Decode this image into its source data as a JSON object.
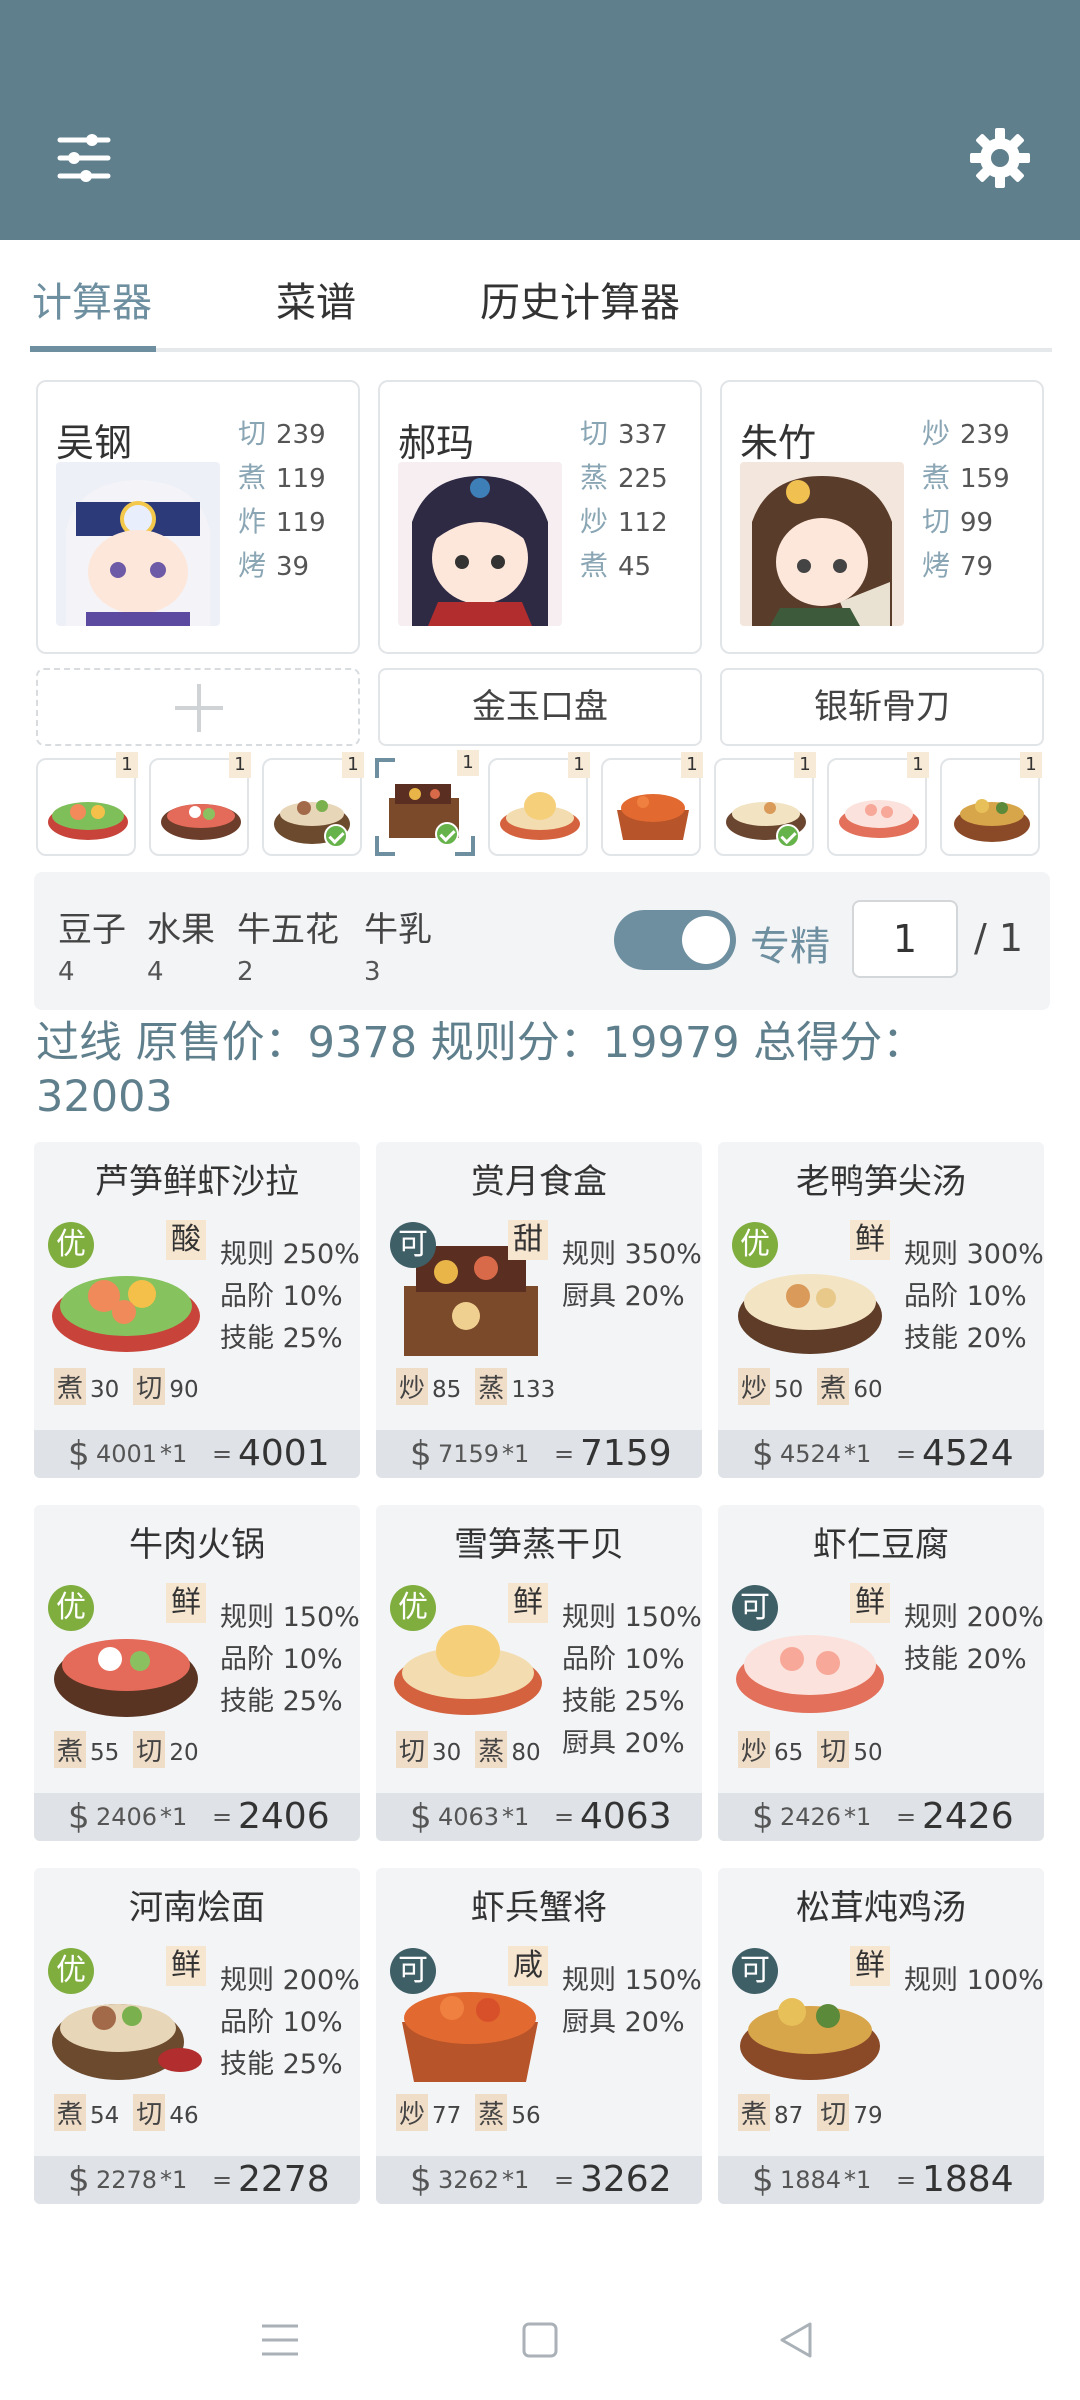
{
  "tabs": [
    "计算器",
    "菜谱",
    "历史计算器"
  ],
  "chefs": [
    {
      "name": "吴钢",
      "skills": [
        {
          "k": "切",
          "v": "239"
        },
        {
          "k": "煮",
          "v": "119"
        },
        {
          "k": "炸",
          "v": "119"
        },
        {
          "k": "烤",
          "v": "39"
        }
      ]
    },
    {
      "name": "郝玛",
      "skills": [
        {
          "k": "切",
          "v": "337"
        },
        {
          "k": "蒸",
          "v": "225"
        },
        {
          "k": "炒",
          "v": "112"
        },
        {
          "k": "煮",
          "v": "45"
        }
      ]
    },
    {
      "name": "朱竹",
      "skills": [
        {
          "k": "炒",
          "v": "239"
        },
        {
          "k": "煮",
          "v": "159"
        },
        {
          "k": "切",
          "v": "99"
        },
        {
          "k": "烤",
          "v": "79"
        }
      ]
    }
  ],
  "equipment": [
    "",
    "金玉口盘",
    "银斩骨刀"
  ],
  "thumb_count": "1",
  "ingredients": [
    {
      "name": "豆子",
      "count": "4"
    },
    {
      "name": "水果",
      "count": "4"
    },
    {
      "name": "牛五花",
      "count": "2"
    },
    {
      "name": "牛乳",
      "count": "3"
    }
  ],
  "special_label": "专精",
  "quantity": "1",
  "quantity_total": "/ 1",
  "summary": "过线 原售价：9378 规则分：19979 总得分：32003",
  "dishes": [
    {
      "name": "芦笋鲜虾沙拉",
      "grade": "优",
      "taste": "酸",
      "mods": [
        "规则 250%",
        "品阶 10%",
        "技能 25%"
      ],
      "reqs": [
        {
          "k": "煮",
          "v": "30"
        },
        {
          "k": "切",
          "v": "90"
        }
      ],
      "base": "4001",
      "mult": "*1",
      "final": "4001"
    },
    {
      "name": "赏月食盒",
      "grade": "可",
      "taste": "甜",
      "mods": [
        "规则 350%",
        "厨具 20%"
      ],
      "reqs": [
        {
          "k": "炒",
          "v": "85"
        },
        {
          "k": "蒸",
          "v": "133"
        }
      ],
      "base": "7159",
      "mult": "*1",
      "final": "7159"
    },
    {
      "name": "老鸭笋尖汤",
      "grade": "优",
      "taste": "鲜",
      "mods": [
        "规则 300%",
        "品阶 10%",
        "技能 20%"
      ],
      "reqs": [
        {
          "k": "炒",
          "v": "50"
        },
        {
          "k": "煮",
          "v": "60"
        }
      ],
      "base": "4524",
      "mult": "*1",
      "final": "4524"
    },
    {
      "name": "牛肉火锅",
      "grade": "优",
      "taste": "鲜",
      "mods": [
        "规则 150%",
        "品阶 10%",
        "技能 25%"
      ],
      "reqs": [
        {
          "k": "煮",
          "v": "55"
        },
        {
          "k": "切",
          "v": "20"
        }
      ],
      "base": "2406",
      "mult": "*1",
      "final": "2406"
    },
    {
      "name": "雪笋蒸干贝",
      "grade": "优",
      "taste": "鲜",
      "mods": [
        "规则 150%",
        "品阶 10%",
        "技能 25%",
        "厨具 20%"
      ],
      "reqs": [
        {
          "k": "切",
          "v": "30"
        },
        {
          "k": "蒸",
          "v": "80"
        }
      ],
      "base": "4063",
      "mult": "*1",
      "final": "4063"
    },
    {
      "name": "虾仁豆腐",
      "grade": "可",
      "taste": "鲜",
      "mods": [
        "规则 200%",
        "技能 20%"
      ],
      "reqs": [
        {
          "k": "炒",
          "v": "65"
        },
        {
          "k": "切",
          "v": "50"
        }
      ],
      "base": "2426",
      "mult": "*1",
      "final": "2426"
    },
    {
      "name": "河南烩面",
      "grade": "优",
      "taste": "鲜",
      "mods": [
        "规则 200%",
        "品阶 10%",
        "技能 25%"
      ],
      "reqs": [
        {
          "k": "煮",
          "v": "54"
        },
        {
          "k": "切",
          "v": "46"
        }
      ],
      "base": "2278",
      "mult": "*1",
      "final": "2278"
    },
    {
      "name": "虾兵蟹将",
      "grade": "可",
      "taste": "咸",
      "mods": [
        "规则 150%",
        "厨具 20%"
      ],
      "reqs": [
        {
          "k": "炒",
          "v": "77"
        },
        {
          "k": "蒸",
          "v": "56"
        }
      ],
      "base": "3262",
      "mult": "*1",
      "final": "3262"
    },
    {
      "name": "松茸炖鸡汤",
      "grade": "可",
      "taste": "鲜",
      "mods": [
        "规则 100%"
      ],
      "reqs": [
        {
          "k": "煮",
          "v": "87"
        },
        {
          "k": "切",
          "v": "79"
        }
      ],
      "base": "1884",
      "mult": "*1",
      "final": "1884"
    }
  ],
  "currency_symbol": "$",
  "equals": "=",
  "colors": {
    "appbar": "#5f7f8c",
    "accent": "#6e8fa0",
    "grade_you": "#7fae3e",
    "grade_ke": "#3f5f67"
  }
}
